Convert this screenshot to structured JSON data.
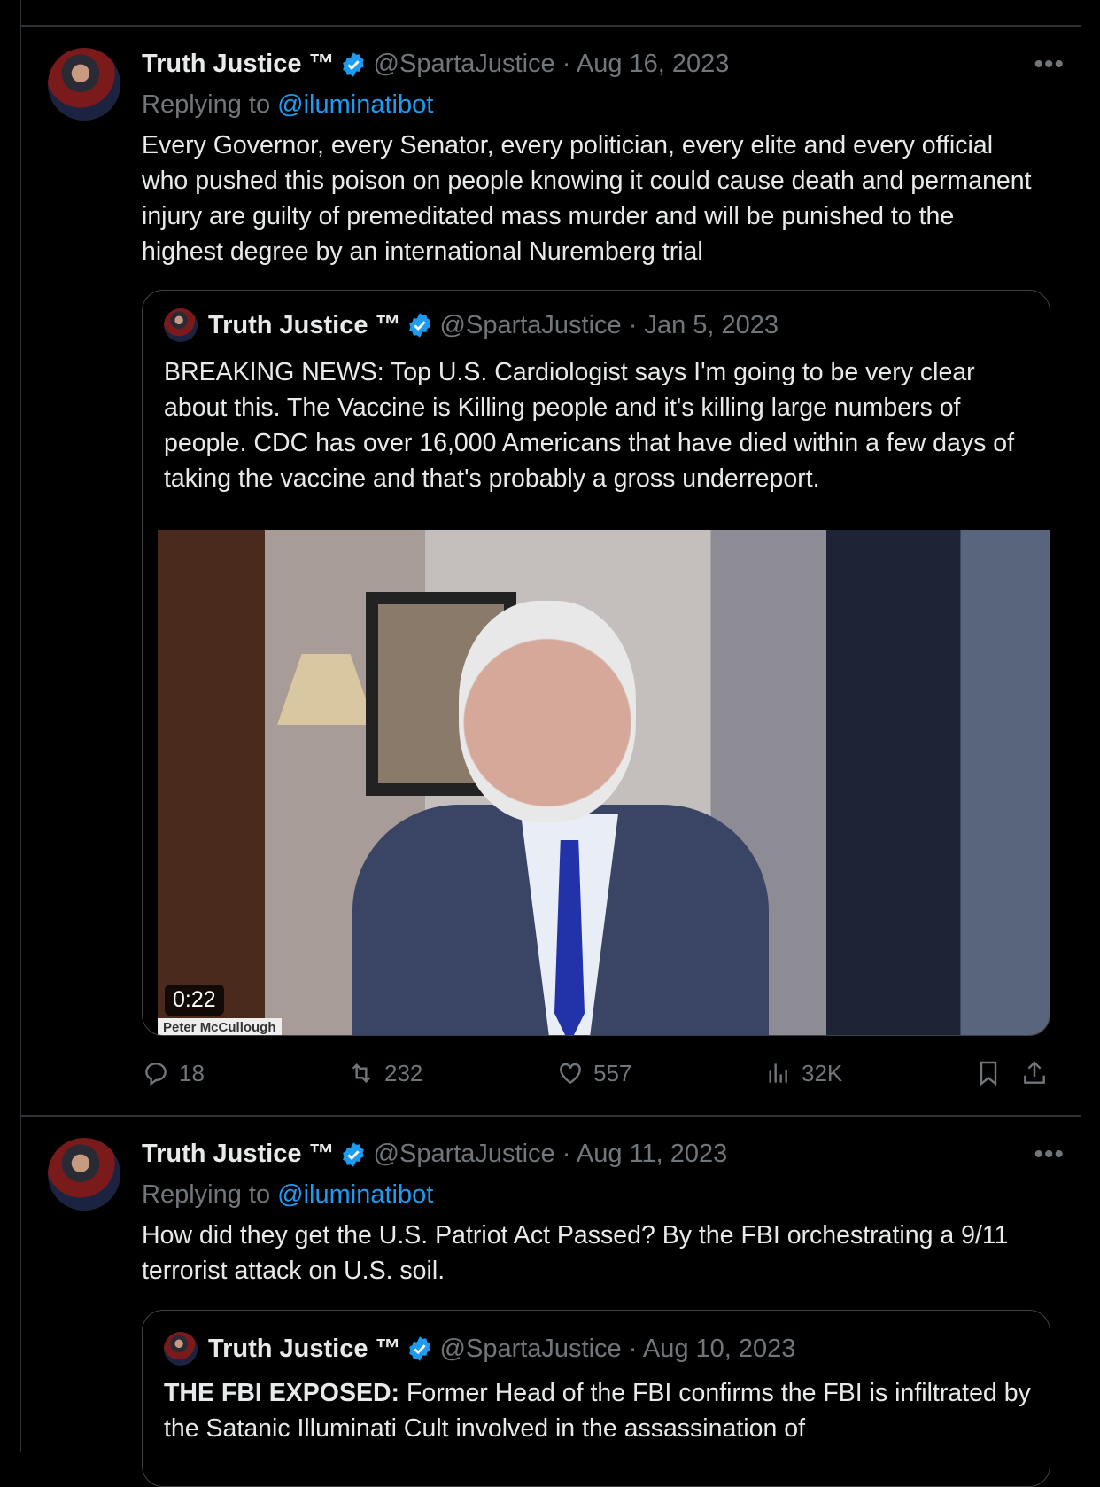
{
  "tweets": [
    {
      "name": "Truth Justice ™",
      "handle": "@SpartaJustice",
      "date": "· Aug 16, 2023",
      "replying_label": "Replying to",
      "replying_to": "@iluminatibot",
      "text": "Every Governor, every Senator, every politician, every elite and every official who pushed this poison on people knowing it could cause death and permanent injury are guilty of premeditated mass murder and will be punished to the highest degree by an international Nuremberg trial",
      "quote": {
        "name": "Truth Justice ™",
        "handle": "@SpartaJustice",
        "date": "· Jan 5, 2023",
        "text": "BREAKING NEWS: Top U.S. Cardiologist says I'm going to be very clear about this. The Vaccine is Killing people and it's killing large numbers of people. CDC has over 16,000 Americans that have died within a few days of taking the vaccine and that's probably a gross underreport.",
        "video_duration": "0:22",
        "video_caption": "Peter McCullough"
      },
      "actions": {
        "replies": "18",
        "reposts": "232",
        "likes": "557",
        "views": "32K"
      }
    },
    {
      "name": "Truth Justice ™",
      "handle": "@SpartaJustice",
      "date": "· Aug 11, 2023",
      "replying_label": "Replying to",
      "replying_to": "@iluminatibot",
      "text": "How did they get the U.S. Patriot Act Passed? By the FBI orchestrating a 9/11 terrorist attack on U.S. soil.",
      "quote": {
        "name": "Truth Justice ™",
        "handle": "@SpartaJustice",
        "date": "· Aug 10, 2023",
        "text_bold": "THE FBI EXPOSED:",
        "text": " Former Head of the FBI confirms the FBI is infiltrated by the Satanic Illuminati Cult involved in the assassination of"
      }
    }
  ],
  "colors": {
    "accent": "#1d9bf0",
    "muted": "#71767b",
    "verified": "#1d9bf0"
  }
}
